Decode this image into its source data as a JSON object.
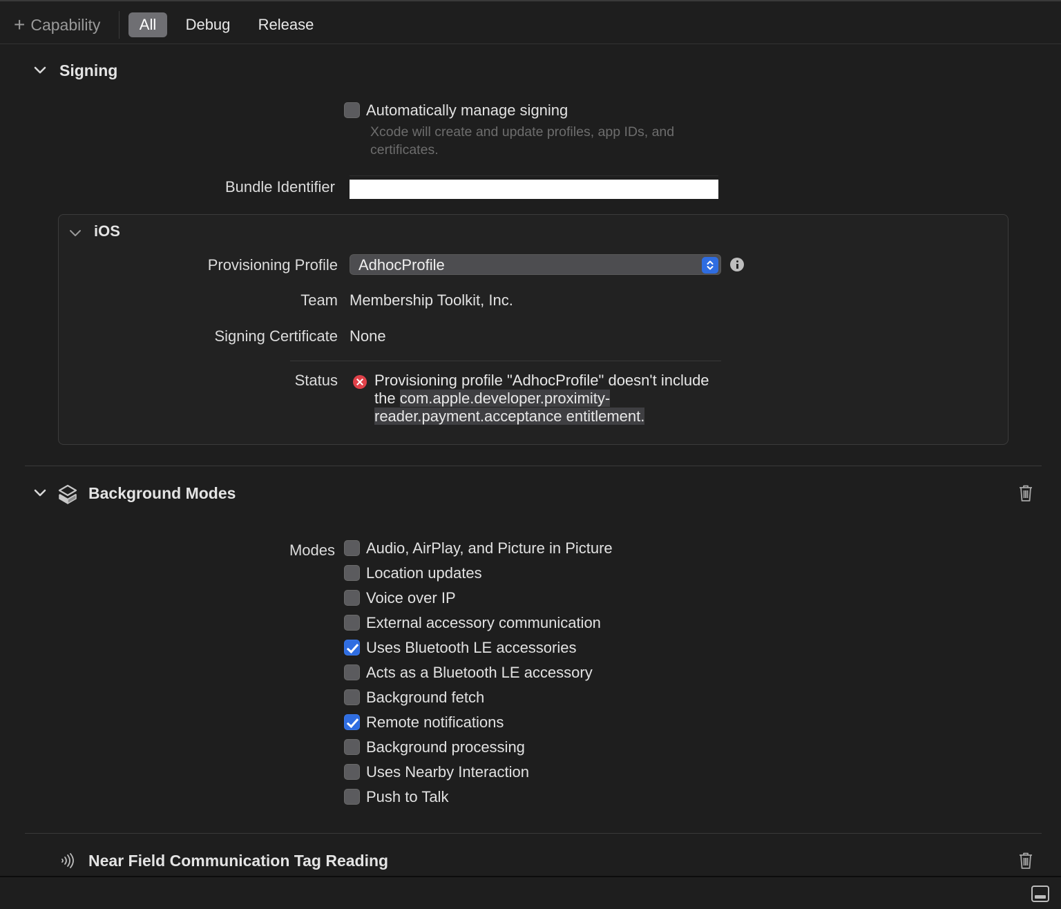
{
  "toolbar": {
    "capability_label": "Capability",
    "tabs": [
      {
        "label": "All",
        "active": true
      },
      {
        "label": "Debug",
        "active": false
      },
      {
        "label": "Release",
        "active": false
      }
    ]
  },
  "signing": {
    "title": "Signing",
    "auto_manage": {
      "label": "Automatically manage signing",
      "checked": false
    },
    "auto_manage_help": "Xcode will create and update profiles, app IDs, and certificates.",
    "bundle_identifier_label": "Bundle Identifier",
    "bundle_identifier_value": "",
    "ios": {
      "title": "iOS",
      "provisioning_profile_label": "Provisioning Profile",
      "provisioning_profile_value": "AdhocProfile",
      "team_label": "Team",
      "team_value": "Membership Toolkit, Inc.",
      "signing_certificate_label": "Signing Certificate",
      "signing_certificate_value": "None",
      "status_label": "Status",
      "status_text_a": "Provisioning profile \"AdhocProfile\" doesn't include the",
      "status_text_b": "com.apple.developer.proximity-reader.payment.acceptance entitlement."
    }
  },
  "background_modes": {
    "title": "Background Modes",
    "modes_label": "Modes",
    "modes": [
      {
        "label": "Audio, AirPlay, and Picture in Picture",
        "checked": false
      },
      {
        "label": "Location updates",
        "checked": false
      },
      {
        "label": "Voice over IP",
        "checked": false
      },
      {
        "label": "External accessory communication",
        "checked": false
      },
      {
        "label": "Uses Bluetooth LE accessories",
        "checked": true
      },
      {
        "label": "Acts as a Bluetooth LE accessory",
        "checked": false
      },
      {
        "label": "Background fetch",
        "checked": false
      },
      {
        "label": "Remote notifications",
        "checked": true
      },
      {
        "label": "Background processing",
        "checked": false
      },
      {
        "label": "Uses Nearby Interaction",
        "checked": false
      },
      {
        "label": "Push to Talk",
        "checked": false
      }
    ]
  },
  "nfc": {
    "title": "Near Field Communication Tag Reading"
  },
  "colors": {
    "background": "#1e1e1e",
    "accent": "#2f6de1",
    "error": "#e0424a"
  }
}
